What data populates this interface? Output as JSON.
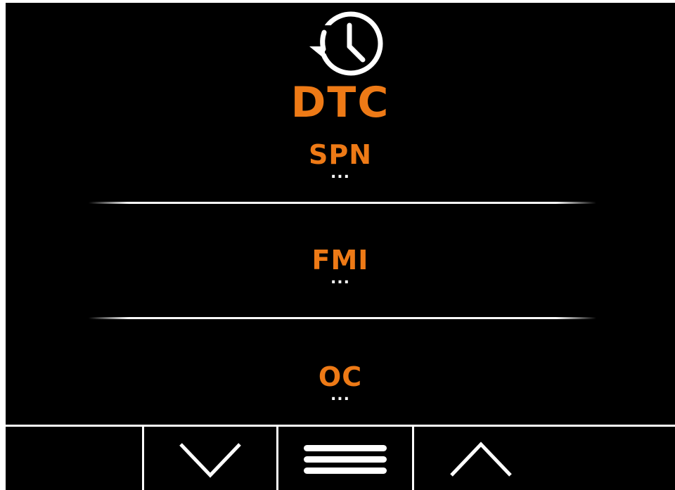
{
  "theme": {
    "accent": "#ee7a16",
    "background": "#000000",
    "foreground": "#ffffff"
  },
  "header": {
    "icon": "history-clock-icon",
    "title": "DTC"
  },
  "fields": [
    {
      "label": "SPN",
      "value": "..."
    },
    {
      "label": "FMI",
      "value": "..."
    },
    {
      "label": "OC",
      "value": "..."
    }
  ],
  "nav": {
    "buttons": [
      {
        "icon": "empty"
      },
      {
        "icon": "chevron-down-icon"
      },
      {
        "icon": "menu-icon"
      },
      {
        "icon": "chevron-up-icon"
      },
      {
        "icon": "empty"
      }
    ]
  }
}
